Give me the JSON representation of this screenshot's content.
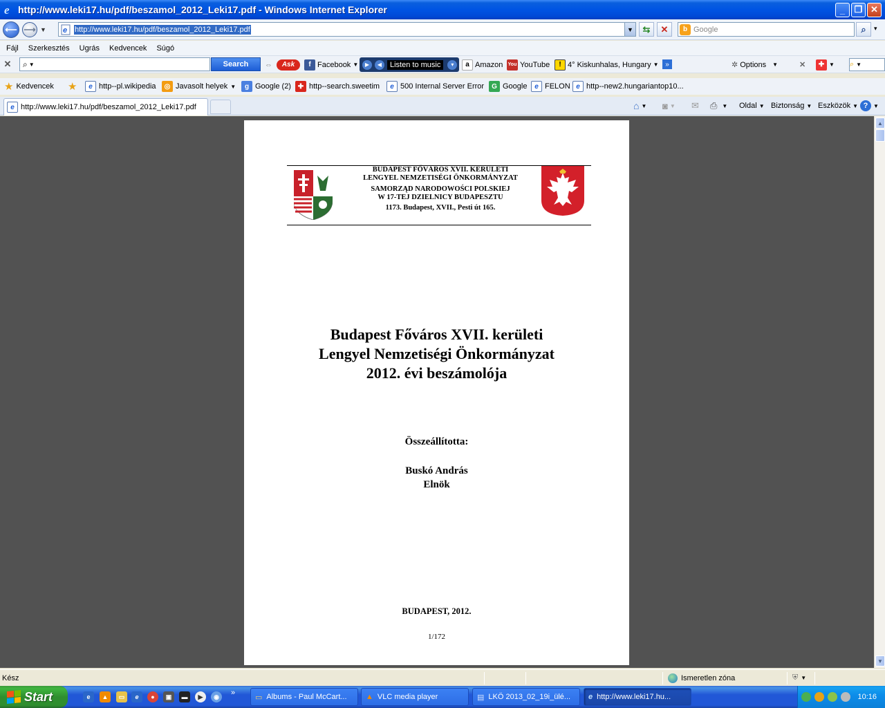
{
  "window": {
    "title": "http://www.leki17.hu/pdf/beszamol_2012_Leki17.pdf - Windows Internet Explorer"
  },
  "address_bar": {
    "url": "http://www.leki17.hu/pdf/beszamol_2012_Leki17.pdf",
    "search_placeholder": "Google"
  },
  "menu": {
    "items": [
      "Fájl",
      "Szerkesztés",
      "Ugrás",
      "Kedvencek",
      "Súgó"
    ]
  },
  "ask_toolbar": {
    "search_label": "Search",
    "facebook": "Facebook",
    "music": "Listen to music",
    "amazon": "Amazon",
    "youtube": "YouTube",
    "weather": "4° Kiskunhalas, Hungary",
    "options": "Options"
  },
  "favorites_bar": {
    "favorites_label": "Kedvencek",
    "links": [
      "http--pl.wikipedia",
      "Javasolt helyek",
      "Google (2)",
      "http--search.sweetim",
      "500 Internal Server Error",
      "Google",
      "FELON",
      "http--new2.hungariantop10..."
    ]
  },
  "tabs": {
    "active_tab": "http://www.leki17.hu/pdf/beszamol_2012_Leki17.pdf",
    "commands": [
      "Oldal",
      "Biztonság",
      "Eszközök"
    ]
  },
  "pdf": {
    "header_lines": [
      "BUDAPEST FŐVÁROS XVII. KERÜLETI",
      "LENGYEL NEMZETISÉGI ÖNKORMÁNYZAT",
      "SAMORZĄD NARODOWOŚCI POLSKIEJ",
      "W 17-TEJ DZIELNICY BUDAPESZTU",
      "1173. Budapest, XVII., Pesti út 165."
    ],
    "title_lines": [
      "Budapest Főváros XVII. kerületi",
      "Lengyel Nemzetiségi Önkormányzat",
      "2012. évi beszámolója"
    ],
    "compiled_by_label": "Összeállította:",
    "author_name": "Buskó András",
    "author_role": "Elnök",
    "place_year": "BUDAPEST, 2012.",
    "page_number": "1/172"
  },
  "status_bar": {
    "status": "Kész",
    "zone": "Ismeretlen zóna"
  },
  "taskbar": {
    "start_label": "Start",
    "tasks": [
      "Albums - Paul McCart...",
      "VLC media player",
      "LKÖ 2013_02_19i_ülé...",
      "http://www.leki17.hu..."
    ],
    "clock": "10:16"
  }
}
